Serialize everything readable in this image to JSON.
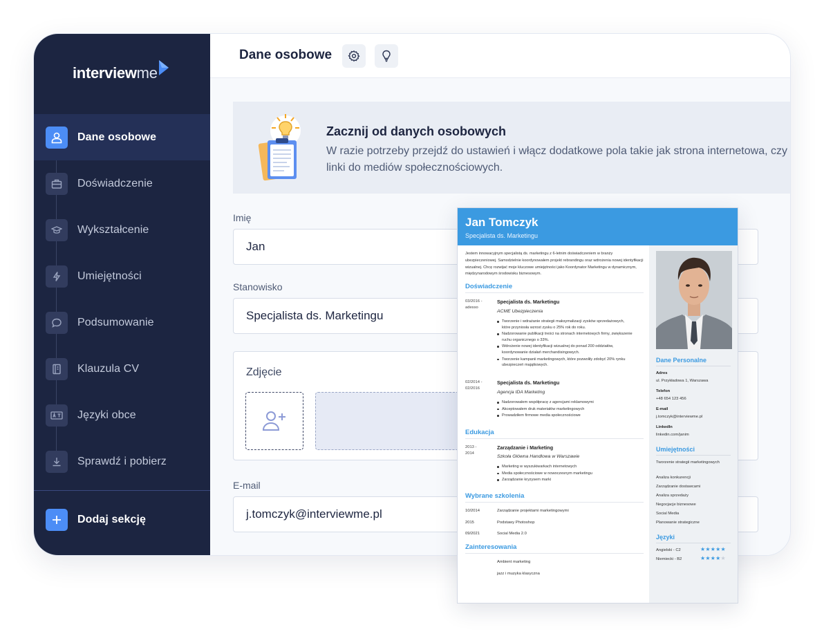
{
  "app": {
    "logo_bold": "interview",
    "logo_light": "me"
  },
  "sidebar": {
    "items": [
      {
        "label": "Dane osobowe",
        "icon": "user-icon",
        "active": true
      },
      {
        "label": "Doświadczenie",
        "icon": "briefcase-icon"
      },
      {
        "label": "Wykształcenie",
        "icon": "graduation-cap-icon"
      },
      {
        "label": "Umiejętności",
        "icon": "lightning-icon"
      },
      {
        "label": "Podsumowanie",
        "icon": "chat-bubble-icon"
      },
      {
        "label": "Klauzula CV",
        "icon": "document-icon"
      },
      {
        "label": "Języki obce",
        "icon": "language-icon"
      },
      {
        "label": "Sprawdź i pobierz",
        "icon": "download-icon"
      }
    ],
    "add_section": "Dodaj sekcję"
  },
  "topbar": {
    "title": "Dane osobowe",
    "settings_icon": "gear-icon",
    "tips_icon": "lightbulb-icon"
  },
  "banner": {
    "title": "Zacznij od danych osobowych",
    "text": "W razie potrzeby przejdź do ustawień i włącz dodatkowe pola takie jak strona internetowa, czy linki do mediów społecznościowych."
  },
  "form": {
    "first_name_label": "Imię",
    "first_name_value": "Jan",
    "position_label": "Stanowisko",
    "position_value": "Specjalista ds. Marketingu",
    "photo_label": "Zdjęcie",
    "email_label": "E-mail",
    "email_value": "j.tomczyk@interviewme.pl"
  },
  "cv": {
    "name": "Jan Tomczyk",
    "role": "Specjalista ds. Marketingu",
    "summary": "Jestem innowacyjnym specjalistą ds. marketingu z 6-letnim doświadczeniem w branży ubezpieczeniowej. Samodzielnie koordynowałem projekt rebrandingu oraz wdrożenia nowej identyfikacji wizualnej. Chcę rozwijać moje kluczowe umiejętności jako Koordynator Marketingu w dynamicznym, międzynarodowym środowisku biznesowym.",
    "experience_title": "Doświadczenie",
    "jobs": [
      {
        "date1": "03/2016 -",
        "date2": "adesso",
        "title": "Specjalista ds. Marketingu",
        "company": "ACME Ubezpieczenia",
        "bullets": [
          "Tworzenie i wdrażanie strategii maksymalizacji zysków sprzedażowych, które przyniosła wzrost zysku o 25% rok do roku.",
          "Nadzorowanie publikacji treści na stronach internetowych firmy, zwiększenie ruchu organicznego o 33%.",
          "Wdrożenie nowej identyfikacji wizualnej do ponad 200 oddziałów, koordynowanie działań merchandisingowych.",
          "Tworzenie kampanii marketingowych, które pozwoliły zdobyć 20% rynku ubezpieczeń majątkowych."
        ]
      },
      {
        "date1": "02/2014 -",
        "date2": "02/2016",
        "title": "Specjalista ds. Marketingu",
        "company": "Agencja IDA Marketing",
        "bullets": [
          "Nadzorowałem współpracę z agencjami reklamowymi",
          "Akceptowałem druk materiałów marketingowych",
          "Prowadziłem firmowe media społecznościowe"
        ]
      }
    ],
    "education_title": "Edukacja",
    "education": {
      "date1": "2013 -",
      "date2": "2014",
      "title": "Zarządzanie i Marketing",
      "school": "Szkoła Główna Handlowa w Warszawie",
      "bullets": [
        "Marketing w wyszukiwarkach internetowych",
        "Media społecznościowe w nowoczesnym marketingu",
        "Zarządzanie kryzysem marki"
      ]
    },
    "trainings_title": "Wybrane szkolenia",
    "trainings": [
      {
        "date": "10/2014",
        "name": "Zarządzanie projektami marketingowymi"
      },
      {
        "date": "2015",
        "name": "Podstawy Photoshop"
      },
      {
        "date": "09/2021",
        "name": "Social Media 2.0"
      }
    ],
    "interests_title": "Zainteresowania",
    "interests": [
      "Ambient marketing",
      "jazz i muzyka klasyczna"
    ],
    "personal_title": "Dane Personalne",
    "personal": [
      {
        "label": "Adres",
        "value": "ul. Przykładowa 1, Warszawa"
      },
      {
        "label": "Telefon",
        "value": "+48 654 123 456"
      },
      {
        "label": "E-mail",
        "value": "j.tomczyk@interviewme.pl"
      },
      {
        "label": "LinkedIn",
        "value": "linkedin.com/janim"
      }
    ],
    "skills_title": "Umiejętności",
    "skills": [
      "Tworzenie strategii marketingowych",
      "Analiza konkurencji",
      "Zarządzanie dostawcami",
      "Analiza sprzedaży",
      "Negocjacje biznesowe",
      "Social Media",
      "Planowanie strategiczne"
    ],
    "languages_title": "Języki",
    "languages": [
      {
        "name": "Angielski - C2",
        "rating": 5
      },
      {
        "name": "Niemiecki - B2",
        "rating": 4
      }
    ],
    "accent_color": "#3b9ae1"
  },
  "colors": {
    "sidebar_bg": "#1c2541",
    "accent": "#4c8df6"
  }
}
